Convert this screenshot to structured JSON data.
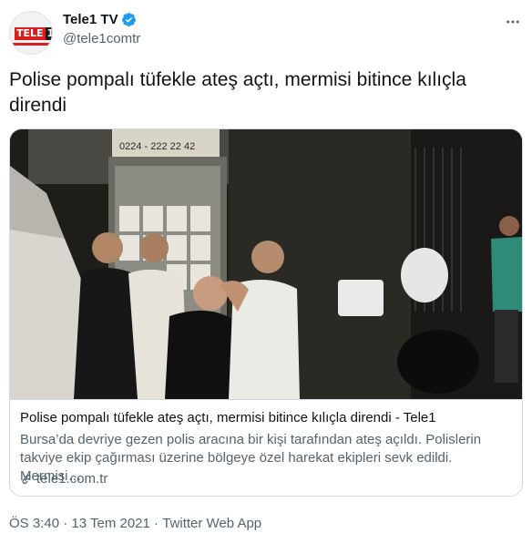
{
  "account": {
    "display_name": "Tele1 TV",
    "handle": "@tele1comtr",
    "avatar_logo_red": "TELE",
    "avatar_logo_black": "1",
    "verified": true,
    "verified_color": "#1d9bf0",
    "brand_color": "#d6201f"
  },
  "tweet": {
    "text": "Polise pompalı tüfekle ateş açtı, mermisi bitince kılıçla direndi"
  },
  "card": {
    "image_sign_top": "0224 - 222 22 42",
    "title": "Polise pompalı tüfekle ateş açtı, mermisi bitince kılıçla direndi - Tele1",
    "description": "Bursa’da devriye gezen polis aracına bir kişi tarafından ateş açıldı. Polislerin takviye ekip çağırması üzerine bölgeye özel harekat ekipleri sevk edildi. Mermisi…",
    "domain": "tele1.com.tr",
    "icon": "link-icon"
  },
  "meta": {
    "time": "ÖS 3:40",
    "separator": " · ",
    "date": "13 Tem 2021",
    "source": "Twitter Web App"
  },
  "icons": {
    "more": "more-icon",
    "verified": "verified-badge-icon"
  }
}
